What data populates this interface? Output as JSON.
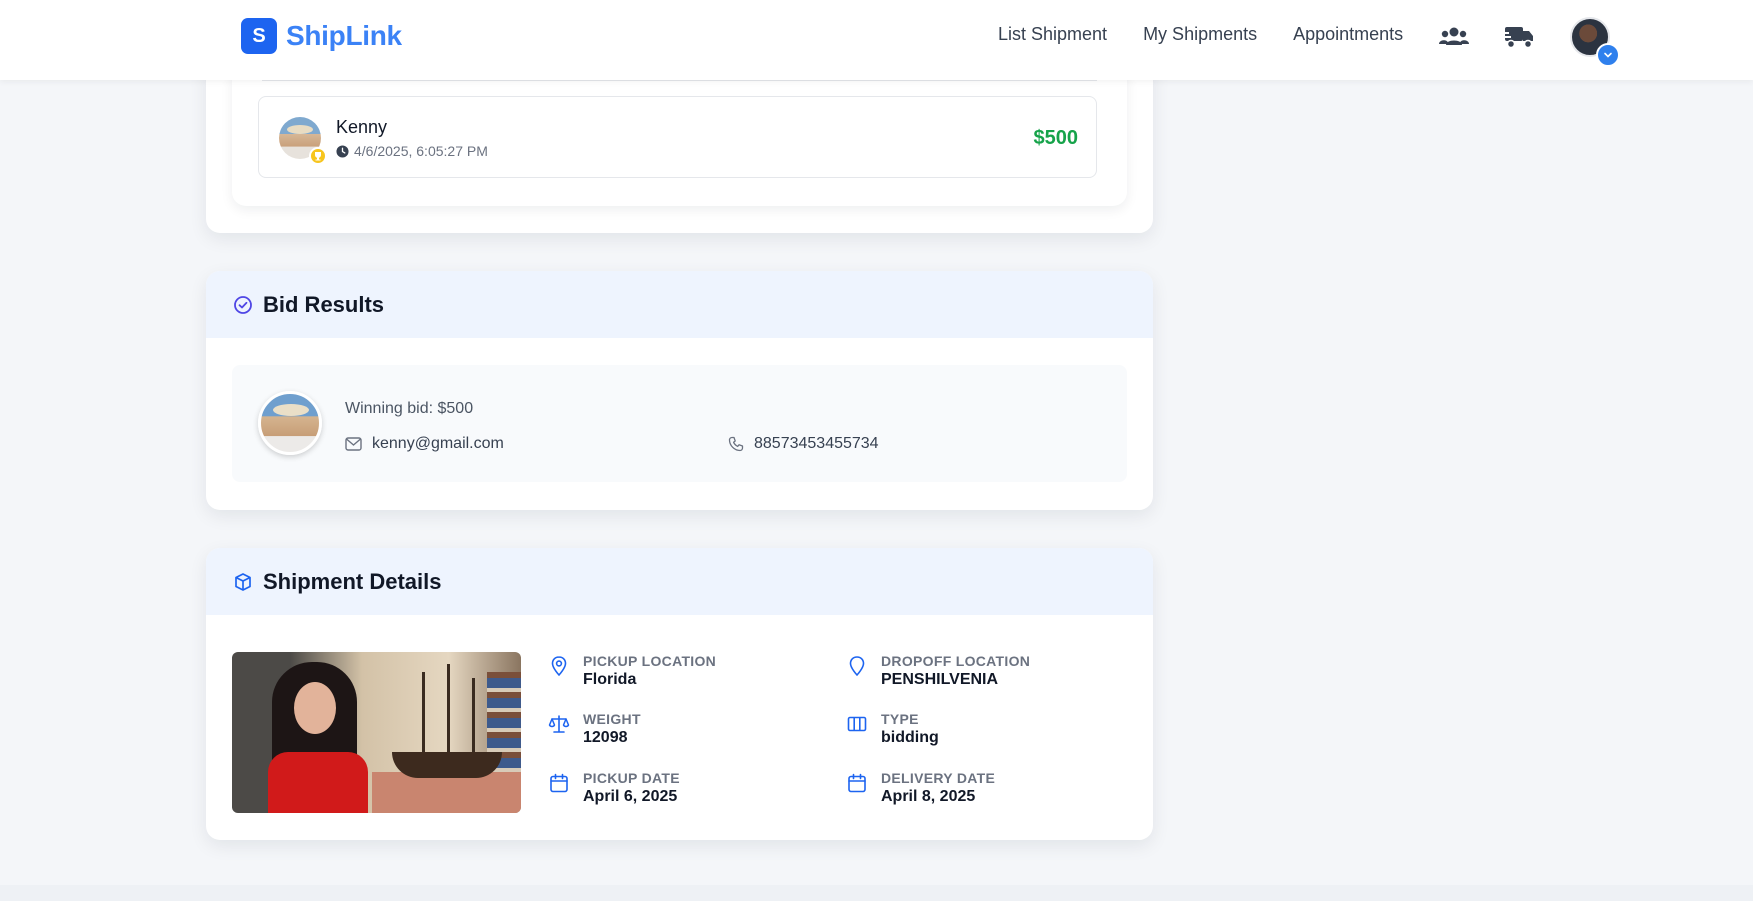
{
  "header": {
    "brand_initial": "S",
    "brand_name": "ShipLink",
    "nav": [
      "List Shipment",
      "My Shipments",
      "Appointments"
    ],
    "icons": [
      "users-icon",
      "truck-icon"
    ],
    "accent": "#1d64f0"
  },
  "bids": {
    "items": [
      {
        "name": "Kenny",
        "time": "4/6/2025, 6:05:27 PM",
        "amount": "$500"
      }
    ]
  },
  "bid_results": {
    "title": "Bid Results",
    "winning_bid": "Winning bid: $500",
    "email": "kenny@gmail.com",
    "phone": "88573453455734"
  },
  "shipment_details": {
    "title": "Shipment Details",
    "pickup_location_label": "PICKUP LOCATION",
    "pickup_location": "Florida",
    "dropoff_location_label": "DROPOFF LOCATION",
    "dropoff_location": "PENSHILVENIA",
    "weight_label": "WEIGHT",
    "weight": "12098",
    "type_label": "TYPE",
    "type": "bidding",
    "pickup_date_label": "PICKUP DATE",
    "pickup_date": "April 6, 2025",
    "delivery_date_label": "DELIVERY DATE",
    "delivery_date": "April 8, 2025"
  },
  "colors": {
    "primary": "#3b82f6",
    "success": "#16a34a",
    "header_bg": "#eef4fe"
  }
}
